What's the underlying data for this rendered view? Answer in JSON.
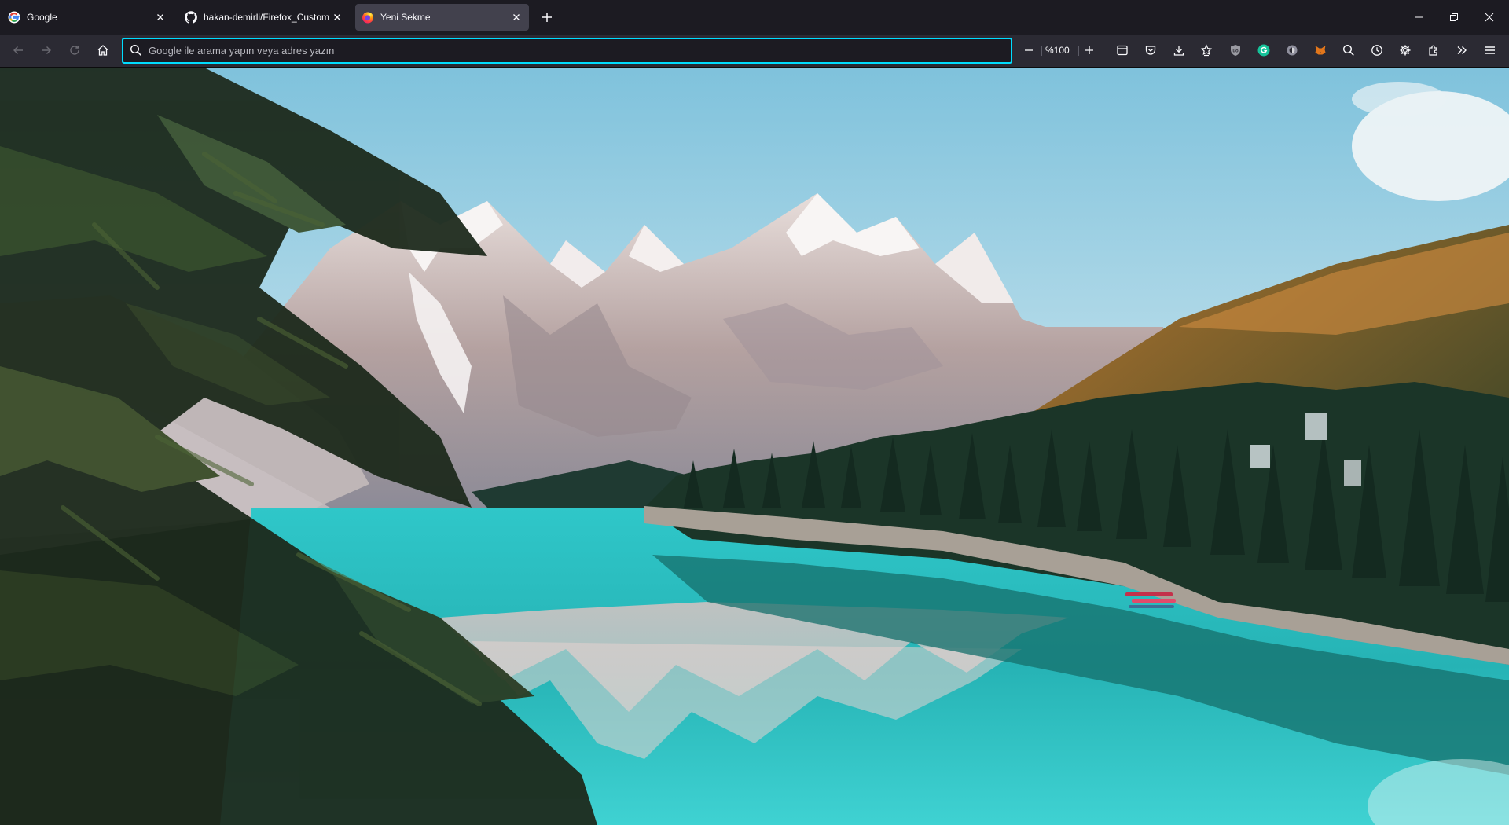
{
  "tabs": [
    {
      "title": "Google",
      "icon": "google-icon"
    },
    {
      "title": "hakan-demirli/Firefox_Custom_",
      "icon": "github-icon"
    },
    {
      "title": "Yeni Sekme",
      "icon": "firefox-icon",
      "active": true
    }
  ],
  "urlbar": {
    "placeholder": "Google ile arama yapın veya adres yazın",
    "value": ""
  },
  "zoom": {
    "label": "%100"
  },
  "colors": {
    "focus_ring": "#00ddff",
    "toolbar": "#2b2a33",
    "tabstrip": "#1c1b22",
    "active_tab": "#42414d"
  },
  "content": {
    "image": "mountain-lake-wallpaper"
  }
}
